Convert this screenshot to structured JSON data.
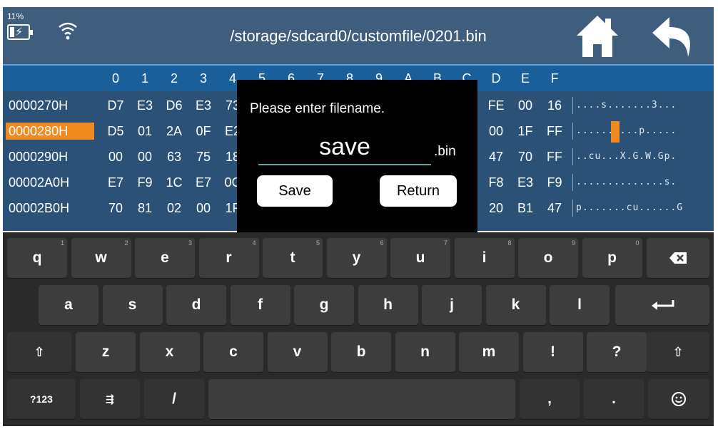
{
  "status": {
    "battery_percent": "11%",
    "battery_icon": "battery-charging-icon",
    "wifi_icon": "wifi-icon"
  },
  "header": {
    "path": "/storage/sdcard0/customfile/0201.bin",
    "home_icon": "home-icon",
    "back_icon": "back-arrow-icon"
  },
  "hex": {
    "column_headers": [
      "0",
      "1",
      "2",
      "3",
      "4",
      "5",
      "6",
      "7",
      "8",
      "9",
      "A",
      "B",
      "C",
      "D",
      "E",
      "F"
    ],
    "rows": [
      {
        "address": "0000270H",
        "left": [
          "D7",
          "E3",
          "D6",
          "E3",
          "73"
        ],
        "right": [
          "FE",
          "00",
          "16"
        ],
        "ascii": "....s.......3..."
      },
      {
        "address": "0000280H",
        "left": [
          "D5",
          "01",
          "2A",
          "0F",
          "E2"
        ],
        "right": [
          "00",
          "1F",
          "FF"
        ],
        "ascii": "......s...p....."
      },
      {
        "address": "0000290H",
        "left": [
          "00",
          "00",
          "63",
          "75",
          "18"
        ],
        "right": [
          "47",
          "70",
          "FF"
        ],
        "ascii": "..cu...X.G.W.Gp."
      },
      {
        "address": "00002A0H",
        "left": [
          "E7",
          "F9",
          "1C",
          "E7",
          "0C"
        ],
        "right": [
          "F8",
          "E3",
          "F9"
        ],
        "ascii": "..............s."
      },
      {
        "address": "00002B0H",
        "left": [
          "70",
          "81",
          "02",
          "00",
          "1F"
        ],
        "right": [
          "20",
          "B1",
          "47"
        ],
        "ascii": "p.......cu......G"
      }
    ],
    "selected_row": 1
  },
  "dialog": {
    "prompt": "Please enter filename.",
    "filename": "save",
    "extension": ".bin",
    "save_label": "Save",
    "return_label": "Return"
  },
  "keyboard": {
    "row1": [
      {
        "label": "q",
        "num": "1"
      },
      {
        "label": "w",
        "num": "2"
      },
      {
        "label": "e",
        "num": "3"
      },
      {
        "label": "r",
        "num": "4"
      },
      {
        "label": "t",
        "num": "5"
      },
      {
        "label": "y",
        "num": "6"
      },
      {
        "label": "u",
        "num": "7"
      },
      {
        "label": "i",
        "num": "8"
      },
      {
        "label": "o",
        "num": "9"
      },
      {
        "label": "p",
        "num": "0"
      }
    ],
    "row2": [
      "a",
      "s",
      "d",
      "f",
      "g",
      "h",
      "j",
      "k",
      "l"
    ],
    "row3": [
      "z",
      "x",
      "c",
      "v",
      "b",
      "n",
      "m",
      "!",
      "?"
    ],
    "mode_label": "?123",
    "settings_label": "⇶",
    "slash_label": "/",
    "comma_label": ",",
    "period_label": ".",
    "backspace_icon": "backspace-icon",
    "enter_icon": "enter-icon",
    "shift_icon": "shift-icon",
    "emoji_icon": "emoji-icon"
  }
}
